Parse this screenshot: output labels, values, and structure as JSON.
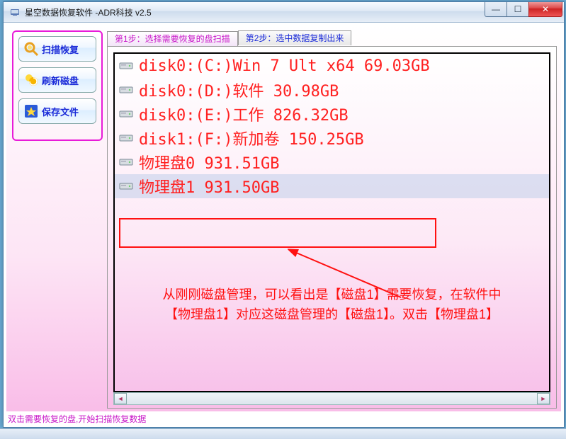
{
  "window": {
    "title": "星空数据恢复软件   -ADR科技 v2.5"
  },
  "sidebar": {
    "buttons": [
      {
        "label": "扫描恢复"
      },
      {
        "label": "刷新磁盘"
      },
      {
        "label": "保存文件"
      }
    ]
  },
  "tabs": {
    "step1": "第1步：选择需要恢复的盘扫描",
    "step2": "第2步：选中数据复制出来"
  },
  "disks": [
    {
      "text": "disk0:(C:)Win 7 Ult x64 69.03GB",
      "selected": false
    },
    {
      "text": "disk0:(D:)软件 30.98GB",
      "selected": false
    },
    {
      "text": "disk0:(E:)工作 826.32GB",
      "selected": false
    },
    {
      "text": "disk1:(F:)新加卷 150.25GB",
      "selected": false
    },
    {
      "text": "物理盘0 931.51GB",
      "selected": false
    },
    {
      "text": "物理盘1 931.50GB",
      "selected": true
    }
  ],
  "annotation": {
    "line1": "从刚刚磁盘管理，可以看出是【磁盘1】需要恢复，在软件中",
    "line2": "【物理盘1】对应这磁盘管理的【磁盘1】。双击【物理盘1】"
  },
  "status": "双击需要恢复的盘,开始扫描恢复数据",
  "glyphs": {
    "left": "◄",
    "right": "►",
    "min": "—",
    "max": "☐",
    "close": "✕"
  }
}
